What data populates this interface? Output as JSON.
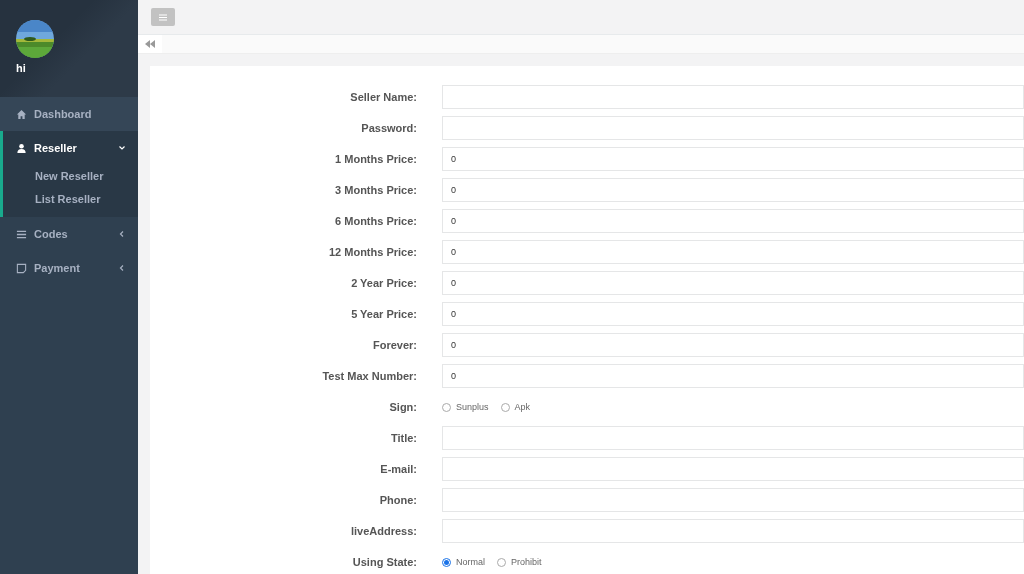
{
  "sidebar": {
    "user": {
      "name": "hi"
    },
    "items": [
      {
        "label": "Dashboard",
        "selected": false
      },
      {
        "label": "Reseller",
        "selected": true,
        "expanded": true,
        "children": [
          {
            "label": "New Reseller"
          },
          {
            "label": "List Reseller"
          }
        ]
      },
      {
        "label": "Codes",
        "selected": false,
        "expanded": false
      },
      {
        "label": "Payment",
        "selected": false,
        "expanded": false
      }
    ]
  },
  "form": {
    "fields": [
      {
        "label": "Seller Name:",
        "kind": "text"
      },
      {
        "label": "Password:",
        "kind": "text"
      },
      {
        "label": "1 Months Price:",
        "kind": "text",
        "value": "0"
      },
      {
        "label": "3 Months Price:",
        "kind": "text",
        "value": "0"
      },
      {
        "label": "6 Months Price:",
        "kind": "text",
        "value": "0"
      },
      {
        "label": "12 Months Price:",
        "kind": "text",
        "value": "0"
      },
      {
        "label": "2 Year Price:",
        "kind": "text",
        "value": "0"
      },
      {
        "label": "5 Year Price:",
        "kind": "text",
        "value": "0"
      },
      {
        "label": "Forever:",
        "kind": "text",
        "value": "0"
      },
      {
        "label": "Test Max Number:",
        "kind": "text",
        "value": "0"
      },
      {
        "label": "Sign:",
        "kind": "radio",
        "options": [
          {
            "label": "Sunplus",
            "selected": false
          },
          {
            "label": "Apk",
            "selected": false
          }
        ]
      },
      {
        "label": "Title:",
        "kind": "text"
      },
      {
        "label": "E-mail:",
        "kind": "text"
      },
      {
        "label": "Phone:",
        "kind": "text"
      },
      {
        "label": "liveAddress:",
        "kind": "text"
      },
      {
        "label": "Using State:",
        "kind": "radio",
        "options": [
          {
            "label": "Normal",
            "selected": true
          },
          {
            "label": "Prohibit",
            "selected": false
          }
        ]
      }
    ]
  }
}
